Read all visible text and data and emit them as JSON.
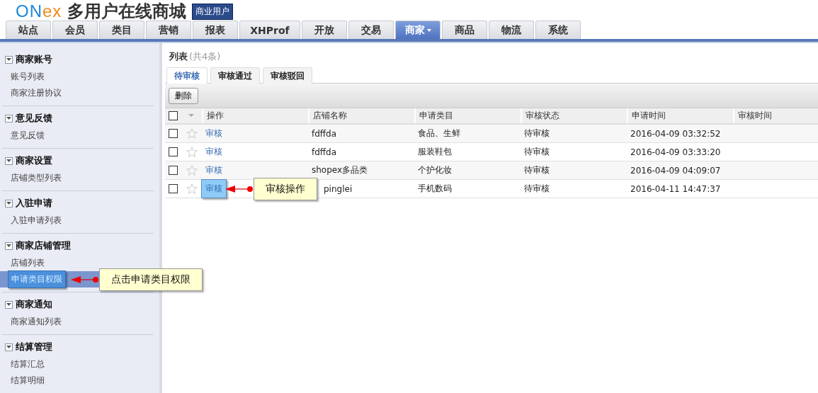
{
  "header": {
    "logo": {
      "part1": "ON",
      "part2": "ex"
    },
    "title": "多用户在线商城",
    "badge": "商业用户"
  },
  "nav_tabs": [
    {
      "label": "站点",
      "selected": false,
      "dropdown": false
    },
    {
      "label": "会员",
      "selected": false,
      "dropdown": false
    },
    {
      "label": "类目",
      "selected": false,
      "dropdown": false
    },
    {
      "label": "营销",
      "selected": false,
      "dropdown": false
    },
    {
      "label": "报表",
      "selected": false,
      "dropdown": false
    },
    {
      "label": "XHProf",
      "selected": false,
      "dropdown": false
    },
    {
      "label": "开放",
      "selected": false,
      "dropdown": false
    },
    {
      "label": "交易",
      "selected": false,
      "dropdown": false
    },
    {
      "label": "商家",
      "selected": true,
      "dropdown": true
    },
    {
      "label": "商品",
      "selected": false,
      "dropdown": false
    },
    {
      "label": "物流",
      "selected": false,
      "dropdown": false
    },
    {
      "label": "系统",
      "selected": false,
      "dropdown": false
    }
  ],
  "sidebar": {
    "sections": [
      {
        "title": "商家账号",
        "expanded": true,
        "items": [
          {
            "label": "账号列表",
            "selected": false
          },
          {
            "label": "商家注册协议",
            "selected": false
          }
        ]
      },
      {
        "title": "意见反馈",
        "expanded": true,
        "items": [
          {
            "label": "意见反馈",
            "selected": false
          }
        ]
      },
      {
        "title": "商家设置",
        "expanded": true,
        "items": [
          {
            "label": "店铺类型列表",
            "selected": false
          }
        ]
      },
      {
        "title": "入驻申请",
        "expanded": true,
        "items": [
          {
            "label": "入驻申请列表",
            "selected": false
          }
        ]
      },
      {
        "title": "商家店铺管理",
        "expanded": true,
        "items": [
          {
            "label": "店铺列表",
            "selected": false
          },
          {
            "label": "申请类目权限",
            "selected": true,
            "callout": "点击申请类目权限"
          }
        ]
      },
      {
        "title": "商家通知",
        "expanded": true,
        "items": [
          {
            "label": "商家通知列表",
            "selected": false
          }
        ]
      },
      {
        "title": "结算管理",
        "expanded": true,
        "items": [
          {
            "label": "结算汇总",
            "selected": false
          },
          {
            "label": "结算明细",
            "selected": false
          }
        ]
      }
    ]
  },
  "main": {
    "title": "列表",
    "count": "(共4条)",
    "tabs": [
      {
        "label": "待审核",
        "selected": true
      },
      {
        "label": "审核通过",
        "selected": false
      },
      {
        "label": "审核驳回",
        "selected": false
      }
    ],
    "toolbar": {
      "delete_button": "删除"
    },
    "table": {
      "all_checked": false,
      "columns": [
        "操作",
        "店铺名称",
        "申请类目",
        "审核状态",
        "申请时间",
        "审核时间"
      ],
      "rows": [
        {
          "checked": false,
          "starred": false,
          "action": "审核",
          "action_highlighted": false,
          "shop": "fdffda",
          "category": "食品、生鲜",
          "status": "待审核",
          "applied": "2016-04-09 03:32:52"
        },
        {
          "checked": false,
          "starred": false,
          "action": "审核",
          "action_highlighted": false,
          "shop": "fdffda",
          "category": "服装鞋包",
          "status": "待审核",
          "applied": "2016-04-09 03:33:20"
        },
        {
          "checked": false,
          "starred": false,
          "action": "审核",
          "action_highlighted": false,
          "shop": "shopex多品类",
          "category": "个护化妆",
          "status": "待审核",
          "applied": "2016-04-09 04:09:07"
        },
        {
          "checked": false,
          "starred": false,
          "action": "审核",
          "action_highlighted": true,
          "callout": "审核操作",
          "shop": "pinglei",
          "category": "手机数码",
          "status": "待审核",
          "applied": "2016-04-11 14:47:37"
        }
      ]
    }
  }
}
